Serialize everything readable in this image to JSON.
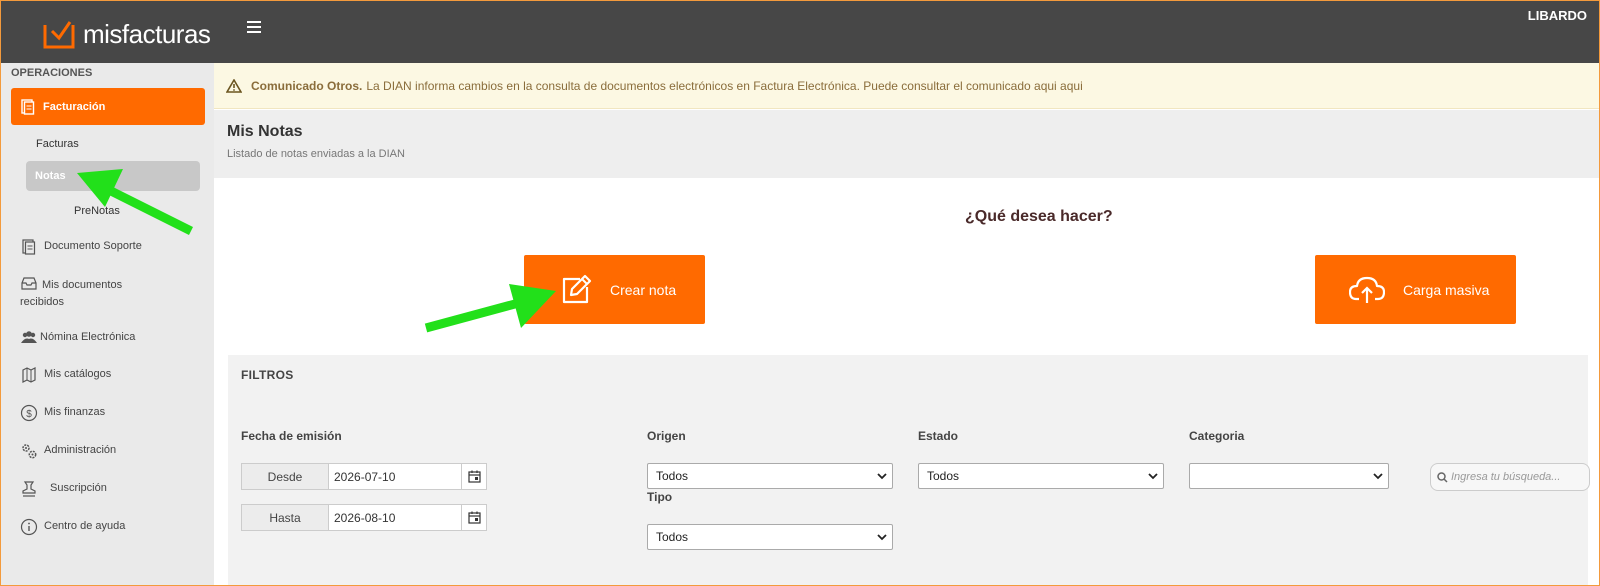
{
  "header": {
    "brand": "misfacturas",
    "user": "LIBARDO",
    "accent_color": "#ff6a00",
    "bar_color": "#474747"
  },
  "sidebar": {
    "section_title": "OPERACIONES",
    "active_item": {
      "label": "Facturación",
      "icon": "invoice-icon"
    },
    "subitems": [
      {
        "label": "Facturas"
      },
      {
        "label": "Notas"
      },
      {
        "label": "PreNotas"
      }
    ],
    "items": [
      {
        "label": "Documento Soporte",
        "icon": "document-icon"
      },
      {
        "label": "Mis documentos recibidos",
        "icon": "inbox-icon"
      },
      {
        "label": "Nómina Electrónica",
        "icon": "users-icon"
      },
      {
        "label": "Mis catálogos",
        "icon": "map-icon"
      },
      {
        "label": "Mis finanzas",
        "icon": "dollar-icon"
      },
      {
        "label": "Administración",
        "icon": "gears-icon"
      },
      {
        "label": "Suscripción",
        "icon": "stamp-icon"
      },
      {
        "label": "Centro de ayuda",
        "icon": "info-icon"
      }
    ]
  },
  "alert": {
    "title": "Comunicado Otros.",
    "text": "La DIAN informa cambios en la consulta de documentos electrónicos en Factura Electrónica. Puede consultar el comunicado aqui aqui"
  },
  "page": {
    "title": "Mis Notas",
    "subtitle": "Listado de notas enviadas a la DIAN",
    "question": "¿Qué desea hacer?",
    "create_button": "Crear nota",
    "bulk_button": "Carga masiva"
  },
  "filters": {
    "title": "FILTROS",
    "date_label": "Fecha de emisión",
    "from_label": "Desde",
    "from_value": "2026-07-10",
    "to_label": "Hasta",
    "to_value": "2026-08-10",
    "origin_label": "Origen",
    "origin_value": "Todos",
    "type_label": "Tipo",
    "type_value": "Todos",
    "state_label": "Estado",
    "state_value": "Todos",
    "category_label": "Categoria",
    "category_value": "",
    "search_placeholder": "Ingresa tu búsqueda..."
  }
}
